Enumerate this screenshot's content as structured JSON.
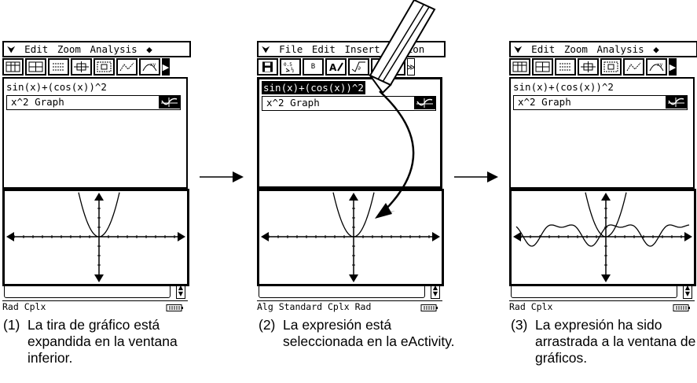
{
  "screens": [
    {
      "menu": [
        "Edit",
        "Zoom",
        "Analysis"
      ],
      "expression": "sin(x)+(cos(x))^2",
      "strip_label": "x^2 Graph",
      "status": "Rad  Cplx",
      "caption_num": "(1)",
      "caption_text": "La tira de gráfico está expandida en la ventana inferior."
    },
    {
      "menu": [
        "File",
        "Edit",
        "Insert",
        "Action"
      ],
      "toolbar_b_label": "B",
      "expression": "sin(x)+(cos(x))^2",
      "strip_label": "x^2 Graph",
      "status": "Alg   Standard Cplx Rad",
      "caption_num": "(2)",
      "caption_text": "La expresión está seleccionada en la eActivity."
    },
    {
      "menu": [
        "Edit",
        "Zoom",
        "Analysis"
      ],
      "expression": "sin(x)+(cos(x))^2",
      "strip_label": "x^2 Graph",
      "status": "Rad  Cplx",
      "caption_num": "(3)",
      "caption_text": "La expresión ha sido arrastrada a la ventana de gráficos."
    }
  ],
  "icons": {
    "menu": "chevron-down-icon",
    "graph": "graph-icon",
    "battery": "battery-icon",
    "stylus": "stylus-icon",
    "next": "arrow-right-icon"
  }
}
